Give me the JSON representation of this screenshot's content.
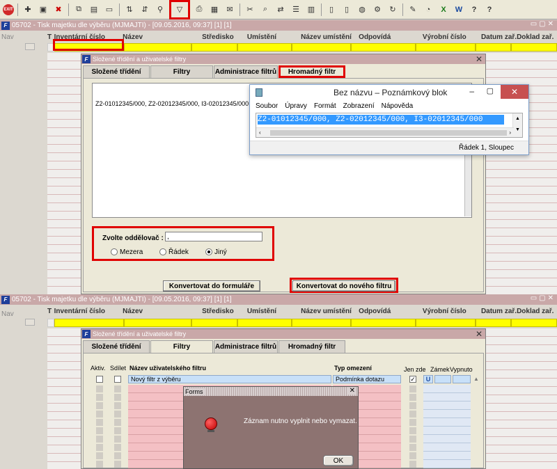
{
  "toolbar": {
    "exit_label": "EXIT",
    "icons": [
      "exit-icon",
      "new-record-icon",
      "save-icon",
      "delete-icon",
      "copy-icon",
      "paste-icon",
      "clear-icon",
      "sort-asc-icon",
      "sort-desc-icon",
      "search-icon",
      "filter-icon",
      "print-icon",
      "print-preview-icon",
      "mail-icon",
      "cut-icon",
      "find-icon",
      "replace-icon",
      "list-icon",
      "columns-icon",
      "doc-icon",
      "doc2-icon",
      "globe-icon",
      "gear-icon",
      "refresh-icon",
      "edit-icon",
      "calc-icon",
      "excel-icon",
      "word-icon",
      "help-icon",
      "whatsthis-icon"
    ]
  },
  "top_window": {
    "title": "05702 - Tisk majetku dle výběru (MJMAJTI) - [09.05.2016, 09:37] [1] [1]",
    "nav_label": "Nav",
    "columns": [
      "T",
      "Inventární číslo",
      "Název",
      "Středisko",
      "Umístění",
      "Název umístění",
      "Odpovídá",
      "Výrobní číslo",
      "Datum zař.",
      "Doklad zař."
    ]
  },
  "filter_dialog": {
    "title": "Složené třídění a uživatelské filtry",
    "tabs": [
      "Složené třídění",
      "Filtry",
      "Administrace filtrů",
      "Hromadný filtr"
    ],
    "text_content": "Z2-01012345/000, Z2-02012345/000, I3-02012345/000",
    "separator_label": "Zvolte oddělovač :",
    "separator_value": ",",
    "radio_options": [
      "Mezera",
      "Řádek",
      "Jiný"
    ],
    "selected_radio": "Jiný",
    "btn_to_form": "Konvertovat do formuláře",
    "btn_to_filter": "Konvertovat do nového filtru"
  },
  "notepad": {
    "title": "Bez názvu – Poznámkový blok",
    "menu": [
      "Soubor",
      "Úpravy",
      "Formát",
      "Zobrazení",
      "Nápověda"
    ],
    "content": "Z2-01012345/000, Z2-02012345/000, I3-02012345/000",
    "status": "Řádek 1, Sloupec"
  },
  "bottom_window": {
    "title": "05702 - Tisk majetku dle výběru (MJMAJTI) - [09.05.2016, 09:37] [1] [1]",
    "nav_label": "Nav",
    "columns": [
      "T",
      "Inventární číslo",
      "Název",
      "Středisko",
      "Umístění",
      "Název umístění",
      "Odpovídá",
      "Výrobní číslo",
      "Datum zař.",
      "Doklad zař."
    ]
  },
  "filters_dialog": {
    "title": "Složené třídění a uživatelské filtry",
    "tabs": [
      "Složené třídění",
      "Filtry",
      "Administrace filtrů",
      "Hromadný filtr"
    ],
    "headers": {
      "aktiv": "Aktiv.",
      "sdilet": "Sdílet",
      "name": "Název uživatelského filtru",
      "type": "Typ omezení",
      "jen_zde": "Jen zde",
      "zamek": "Zámek",
      "vypnuto": "Vypnuto"
    },
    "row1": {
      "name": "Nový filtr z výběru",
      "type": "Podmínka dotazu",
      "zamek": "U"
    }
  },
  "alert": {
    "title": "Forms",
    "message": "Záznam nutno vyplnit nebo vymazat.",
    "ok_label": "OK"
  }
}
